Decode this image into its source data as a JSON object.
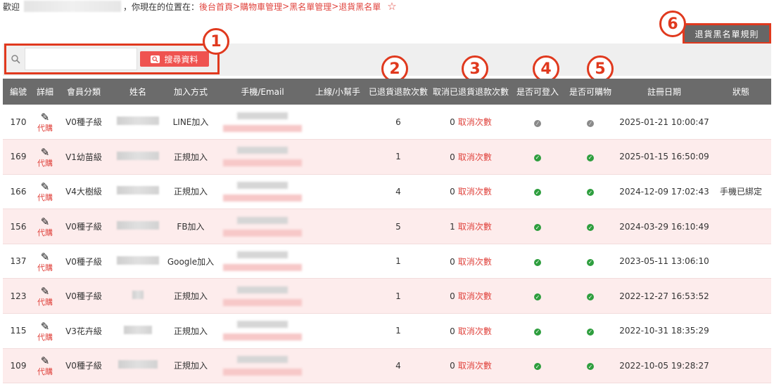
{
  "breadcrumb": {
    "welcome": "歡迎",
    "location_prefix": "，你現在的位置在：",
    "items": [
      "後台首頁",
      "購物車管理",
      "黑名單管理",
      "退貨黑名單"
    ],
    "separator": ">",
    "star_icon": "star-outline-icon"
  },
  "rules_button": {
    "label": "退貨黑名單規則"
  },
  "search": {
    "value": "",
    "placeholder": "",
    "button_label": "搜尋資料"
  },
  "badges": [
    "1",
    "2",
    "3",
    "4",
    "5",
    "6"
  ],
  "table": {
    "headers": [
      "編號",
      "詳細",
      "會員分類",
      "姓名",
      "加入方式",
      "手機/Email",
      "上線/小幫手",
      "已退貨退款次數",
      "取消已退貨退款次數",
      "是否可登入",
      "是否可購物",
      "註冊日期",
      "狀態"
    ],
    "proxy_label": "代購",
    "cancel_label": "取消次數",
    "rows": [
      {
        "id": "170",
        "tier": "V0種子級",
        "join": "LINE加入",
        "returns": "6",
        "cancelled": "0",
        "login": "disabled",
        "shop": "disabled",
        "date": "2025-01-21 10:00:47",
        "status": ""
      },
      {
        "id": "169",
        "tier": "V1幼苗級",
        "join": "正規加入",
        "returns": "1",
        "cancelled": "0",
        "login": "ok",
        "shop": "ok",
        "date": "2025-01-15 16:50:09",
        "status": ""
      },
      {
        "id": "166",
        "tier": "V4大樹級",
        "join": "正規加入",
        "returns": "4",
        "cancelled": "0",
        "login": "ok",
        "shop": "ok",
        "date": "2024-12-09 17:02:43",
        "status": "手機已綁定"
      },
      {
        "id": "156",
        "tier": "V0種子級",
        "join": "FB加入",
        "returns": "5",
        "cancelled": "1",
        "login": "ok",
        "shop": "ok",
        "date": "2024-03-29 16:10:49",
        "status": ""
      },
      {
        "id": "137",
        "tier": "V0種子級",
        "join": "Google加入",
        "returns": "1",
        "cancelled": "0",
        "login": "ok",
        "shop": "ok",
        "date": "2023-05-11 13:06:10",
        "status": ""
      },
      {
        "id": "123",
        "tier": "V0種子級",
        "join": "正規加入",
        "returns": "1",
        "cancelled": "0",
        "login": "ok",
        "shop": "ok",
        "date": "2022-12-27 16:53:52",
        "status": ""
      },
      {
        "id": "115",
        "tier": "V3花卉級",
        "join": "正規加入",
        "returns": "1",
        "cancelled": "0",
        "login": "ok",
        "shop": "ok",
        "date": "2022-10-31 18:35:29",
        "status": ""
      },
      {
        "id": "109",
        "tier": "V0種子級",
        "join": "正規加入",
        "returns": "4",
        "cancelled": "0",
        "login": "ok",
        "shop": "ok",
        "date": "2022-10-05 19:28:27",
        "status": ""
      }
    ]
  },
  "colors": {
    "accent": "#e0443e",
    "header": "#6b6b6b",
    "row_alt": "#fdecec",
    "ok": "#2e9e3e",
    "annotation": "#e0391e"
  }
}
